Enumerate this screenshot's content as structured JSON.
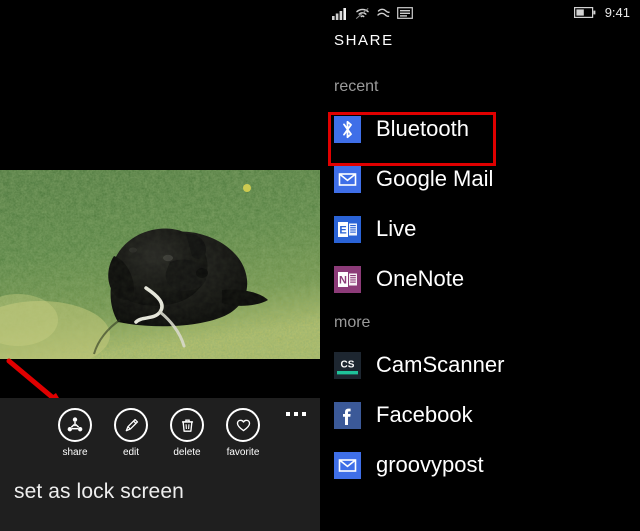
{
  "photo_viewer": {
    "photo_alt": "black labrador dog lying on green grass",
    "commands": [
      {
        "id": "share",
        "label": "share",
        "icon": "share-icon"
      },
      {
        "id": "edit",
        "label": "edit",
        "icon": "pencil-icon"
      },
      {
        "id": "delete",
        "label": "delete",
        "icon": "trash-icon"
      },
      {
        "id": "favorite",
        "label": "favorite",
        "icon": "heart-icon"
      }
    ],
    "more_button": "…",
    "menu_items": [
      "set as lock screen"
    ],
    "lock_screen_label": "set as lock screen",
    "pointer_annotation": {
      "shape": "arrow",
      "color": "#e00000",
      "points_to": "share"
    }
  },
  "share_picker": {
    "status_bar": {
      "icons": [
        "signal-bars-icon",
        "wifi-icon",
        "roaming-icon",
        "sim-card-icon"
      ],
      "battery_icon": "battery-half-icon",
      "time": "9:41"
    },
    "title": "SHARE",
    "sections": [
      {
        "header": "recent",
        "items": [
          {
            "label": "Bluetooth",
            "icon": "bluetooth-icon",
            "icon_bg": "#3f6fe8",
            "highlighted": true
          },
          {
            "label": "Google Mail",
            "icon": "mail-envelope-icon",
            "icon_bg": "#3f6fe8",
            "highlighted": false
          },
          {
            "label": "Live",
            "icon": "exchange-e-icon",
            "icon_bg": "#2a63d6",
            "highlighted": false
          },
          {
            "label": "OneNote",
            "icon": "onenote-n-icon",
            "icon_bg": "#8c3b78",
            "highlighted": false
          }
        ]
      },
      {
        "header": "more",
        "items": [
          {
            "label": "CamScanner",
            "icon": "camscanner-cs-icon",
            "icon_bg": "#1d2630",
            "highlighted": false
          },
          {
            "label": "Facebook",
            "icon": "facebook-f-icon",
            "icon_bg": "#3b5998",
            "highlighted": false
          },
          {
            "label": "groovypost",
            "icon": "mail-envelope-icon",
            "icon_bg": "#3f6fe8",
            "highlighted": false
          }
        ]
      }
    ],
    "highlight_color": "#e00000"
  }
}
